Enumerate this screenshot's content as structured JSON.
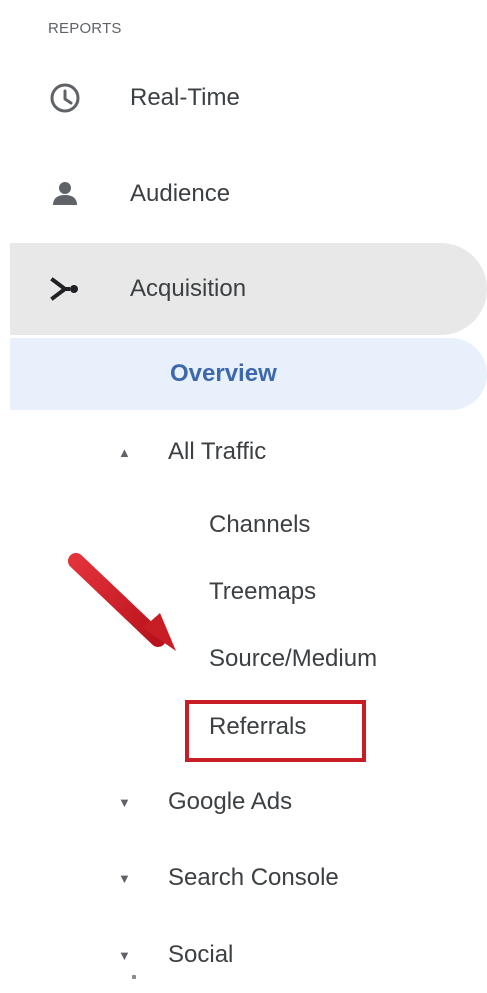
{
  "section": {
    "title": "REPORTS"
  },
  "nav": {
    "realtime": "Real-Time",
    "audience": "Audience",
    "acquisition": "Acquisition",
    "overview": "Overview",
    "all_traffic": "All Traffic",
    "channels": "Channels",
    "treemaps": "Treemaps",
    "source_medium": "Source/Medium",
    "referrals": "Referrals",
    "google_ads": "Google Ads",
    "search_console": "Search Console",
    "social": "Social"
  },
  "arrows": {
    "expanded": "▲",
    "collapsed": "▼"
  },
  "colors": {
    "highlight": "#c81d25",
    "selected_bg": "#e8f0fb",
    "selected_text": "#3c68ad",
    "active_bg": "#e8e8e8"
  },
  "icons": {
    "realtime": "clock-icon",
    "audience": "person-icon",
    "acquisition": "branch-icon"
  }
}
